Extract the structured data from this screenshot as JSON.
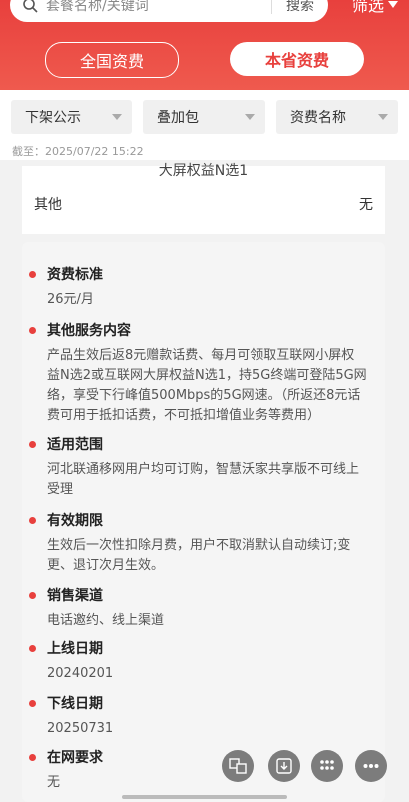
{
  "search": {
    "placeholder": "套餐名称/关键词",
    "button": "搜索"
  },
  "filter_label": "筛选",
  "tabs": {
    "national": "全国资费",
    "province": "本省资费"
  },
  "dropdowns": [
    "下架公示",
    "叠加包",
    "资费名称"
  ],
  "deadline": "截至：2025/07/22 15:22",
  "top_card": {
    "cut_text": "大屏权益N选1",
    "label": "其他",
    "value": "无"
  },
  "details": [
    {
      "title": "资费标准",
      "body": "26元/月"
    },
    {
      "title": "其他服务内容",
      "body": "产品生效后返8元赠款话费、每月可领取互联网小屏权益N选2或互联网大屏权益N选1，持5G终端可登陆5G网络，享受下行峰值500Mbps的5G网速。（所返还8元话费可用于抵扣话费，不可抵扣增值业务等费用）"
    },
    {
      "title": "适用范围",
      "body": "河北联通移网用户均可订购，智慧沃家共享版不可线上受理"
    },
    {
      "title": "有效期限",
      "body": "生效后一次性扣除月费，用户不取消默认自动续订;变更、退订次月生效。"
    },
    {
      "title": "销售渠道",
      "body": "电话邀约、线上渠道"
    },
    {
      "title": "上线日期",
      "body": "20240201"
    },
    {
      "title": "下线日期",
      "body": "20250731"
    },
    {
      "title": "在网要求",
      "body": "无"
    }
  ],
  "icons": {
    "search": "search-icon",
    "filter": "triangle-down-icon",
    "translate": "translate-icon",
    "download": "download-icon",
    "grid": "grid-icon",
    "more": "more-icon"
  },
  "colors": {
    "brand": "#e8403d"
  }
}
